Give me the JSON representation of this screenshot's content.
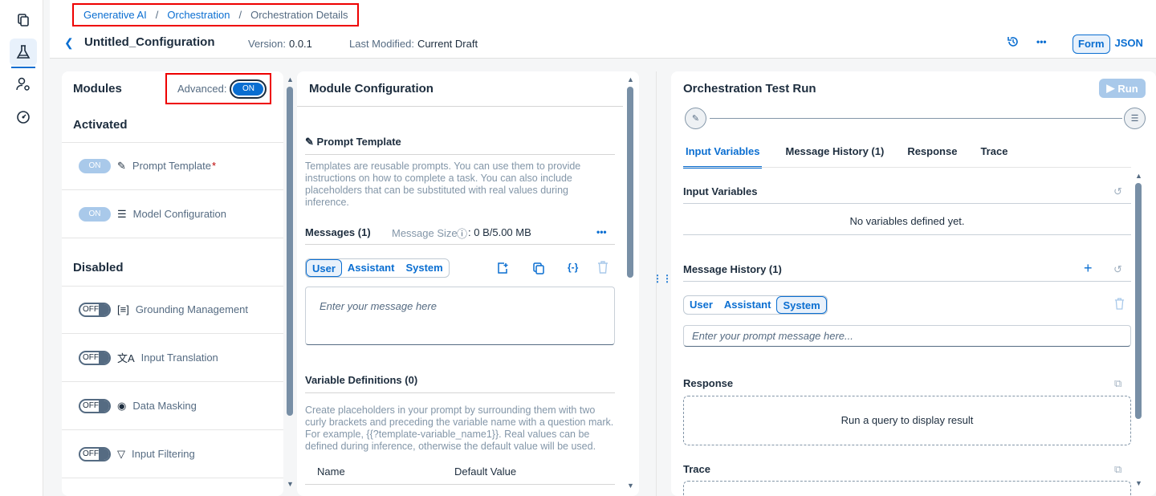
{
  "breadcrumb": {
    "item1": "Generative AI",
    "item2": "Orchestration",
    "current": "Orchestration Details",
    "sep": "/"
  },
  "header": {
    "title": "Untitled_Configuration",
    "version_label": "Version:",
    "version_value": "0.0.1",
    "modified_label": "Last Modified:",
    "modified_value": "Current Draft",
    "more": "•••",
    "form_label": "Form",
    "json_label": "JSON"
  },
  "modules": {
    "title": "Modules",
    "advanced_label": "Advanced:",
    "advanced_state": "ON",
    "activated_heading": "Activated",
    "activated": [
      {
        "toggle": "ON",
        "label": "Prompt Template",
        "required": "*"
      },
      {
        "toggle": "ON",
        "label": "Model Configuration"
      }
    ],
    "disabled_heading": "Disabled",
    "disabled": [
      {
        "toggle": "OFF",
        "label": "Grounding Management"
      },
      {
        "toggle": "OFF",
        "label": "Input Translation"
      },
      {
        "toggle": "OFF",
        "label": "Data Masking"
      },
      {
        "toggle": "OFF",
        "label": "Input Filtering"
      }
    ]
  },
  "config": {
    "title": "Module Configuration",
    "prompt_heading": "Prompt Template",
    "prompt_desc": "Templates are reusable prompts. You can use them to provide instructions on how to complete a task. You can also include placeholders that can be substituted with real values during inference.",
    "messages_label": "Messages (1)",
    "message_size_label": "Message Size",
    "message_size_value": ": 0 B/5.00 MB",
    "more": "•••",
    "role_tabs": [
      "User",
      "Assistant",
      "System"
    ],
    "message_placeholder": "Enter your message here",
    "vardef_heading": "Variable Definitions (0)",
    "vardef_desc": "Create placeholders in your prompt by surrounding them with two curly brackets and preceding the variable name with a question mark. For example, {{?template-variable_name1}}. Real values can be defined during inference, otherwise the default value will be used.",
    "col_name": "Name",
    "col_default": "Default Value"
  },
  "test": {
    "title": "Orchestration Test Run",
    "run_label": "Run",
    "tabs": [
      "Input Variables",
      "Message History (1)",
      "Response",
      "Trace"
    ],
    "input_vars_heading": "Input Variables",
    "no_vars_text": "No variables defined yet.",
    "msg_history_heading": "Message History (1)",
    "role_tabs": [
      "User",
      "Assistant",
      "System"
    ],
    "prompt_placeholder": "Enter your prompt message here...",
    "response_heading": "Response",
    "response_placeholder": "Run a query to display result",
    "trace_heading": "Trace"
  }
}
